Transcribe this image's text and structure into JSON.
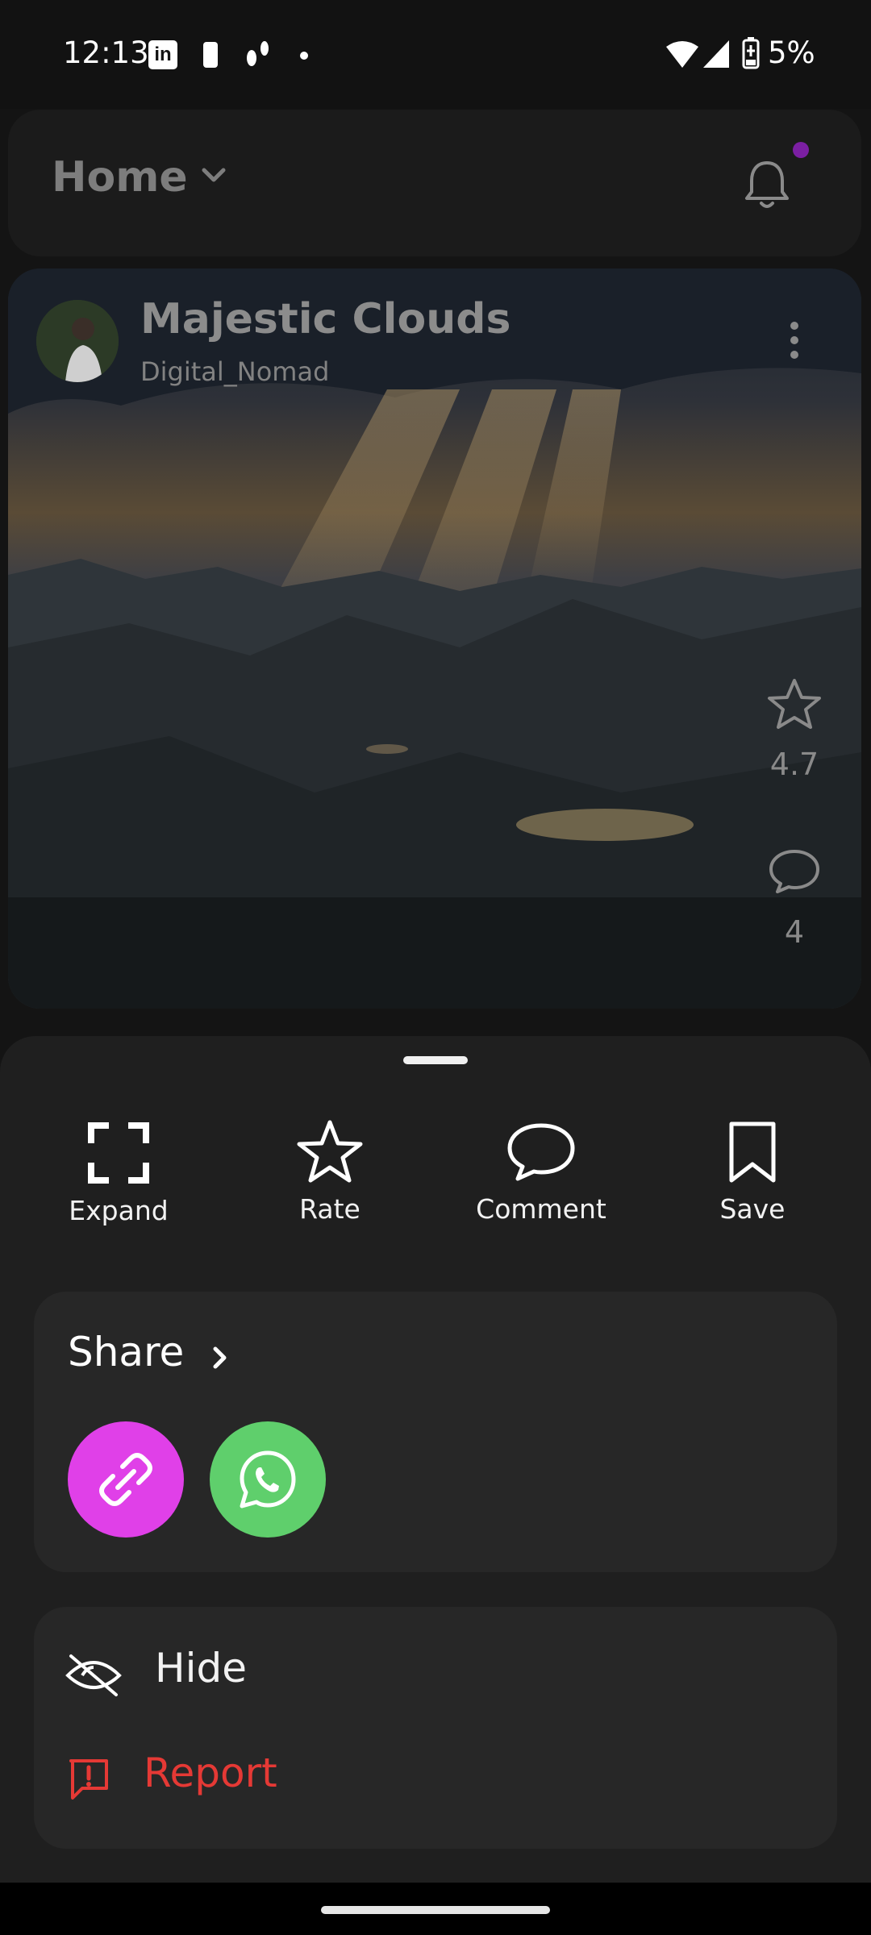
{
  "status_bar": {
    "time": "12:13",
    "battery": "5%",
    "icons": [
      "linkedin-icon",
      "battery-saver-icon",
      "footsteps-icon",
      "dot-icon",
      "wifi-icon",
      "signal-icon",
      "battery-charging-icon"
    ]
  },
  "header": {
    "title": "Home",
    "icons": [
      "chevron-down-icon",
      "bell-icon"
    ]
  },
  "post": {
    "title": "Majestic Clouds",
    "author": "Digital_Nomad",
    "rating": "4.7",
    "comments": "4"
  },
  "sheet": {
    "actions": [
      {
        "label": "Expand",
        "icon": "expand-icon"
      },
      {
        "label": "Rate",
        "icon": "star-icon"
      },
      {
        "label": "Comment",
        "icon": "comment-icon"
      },
      {
        "label": "Save",
        "icon": "bookmark-icon"
      }
    ],
    "share": {
      "title": "Share",
      "buttons": [
        {
          "icon": "link-icon",
          "color": "#e040e8"
        },
        {
          "icon": "whatsapp-icon",
          "color": "#5fcf6c"
        }
      ]
    },
    "options": {
      "hide": "Hide",
      "report": "Report"
    }
  },
  "colors": {
    "accent_report": "#e53935",
    "notification_dot": "#7b1fa2"
  }
}
